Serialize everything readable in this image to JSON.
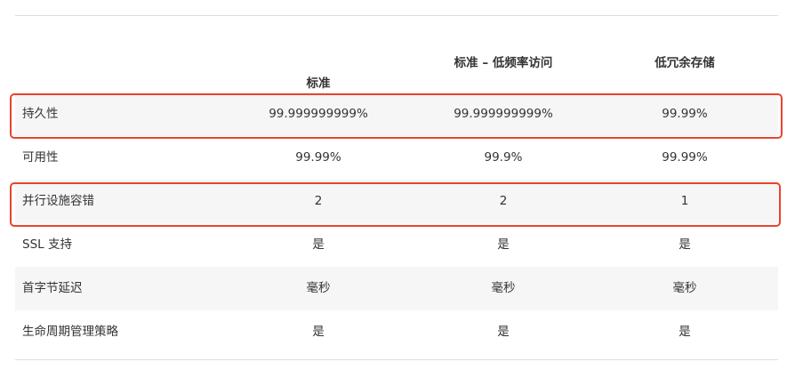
{
  "headers": [
    "",
    "标准",
    "标准 – 低频率访问",
    "低冗余存储"
  ],
  "rows": [
    {
      "label": "持久性",
      "values": [
        "99.999999999%",
        "99.999999999%",
        "99.99%"
      ],
      "highlighted": true
    },
    {
      "label": "可用性",
      "values": [
        "99.99%",
        "99.9%",
        "99.99%"
      ],
      "highlighted": false
    },
    {
      "label": "并行设施容错",
      "values": [
        "2",
        "2",
        "1"
      ],
      "highlighted": true
    },
    {
      "label": "SSL 支持",
      "values": [
        "是",
        "是",
        "是"
      ],
      "highlighted": false
    },
    {
      "label": "首字节延迟",
      "values": [
        "毫秒",
        "毫秒",
        "毫秒"
      ],
      "highlighted": false
    },
    {
      "label": "生命周期管理策略",
      "values": [
        "是",
        "是",
        "是"
      ],
      "highlighted": false
    }
  ],
  "colors": {
    "highlight_border": "#e8442e",
    "row_shade": "#f6f6f6",
    "text": "#333333",
    "rule": "#dddddd"
  }
}
